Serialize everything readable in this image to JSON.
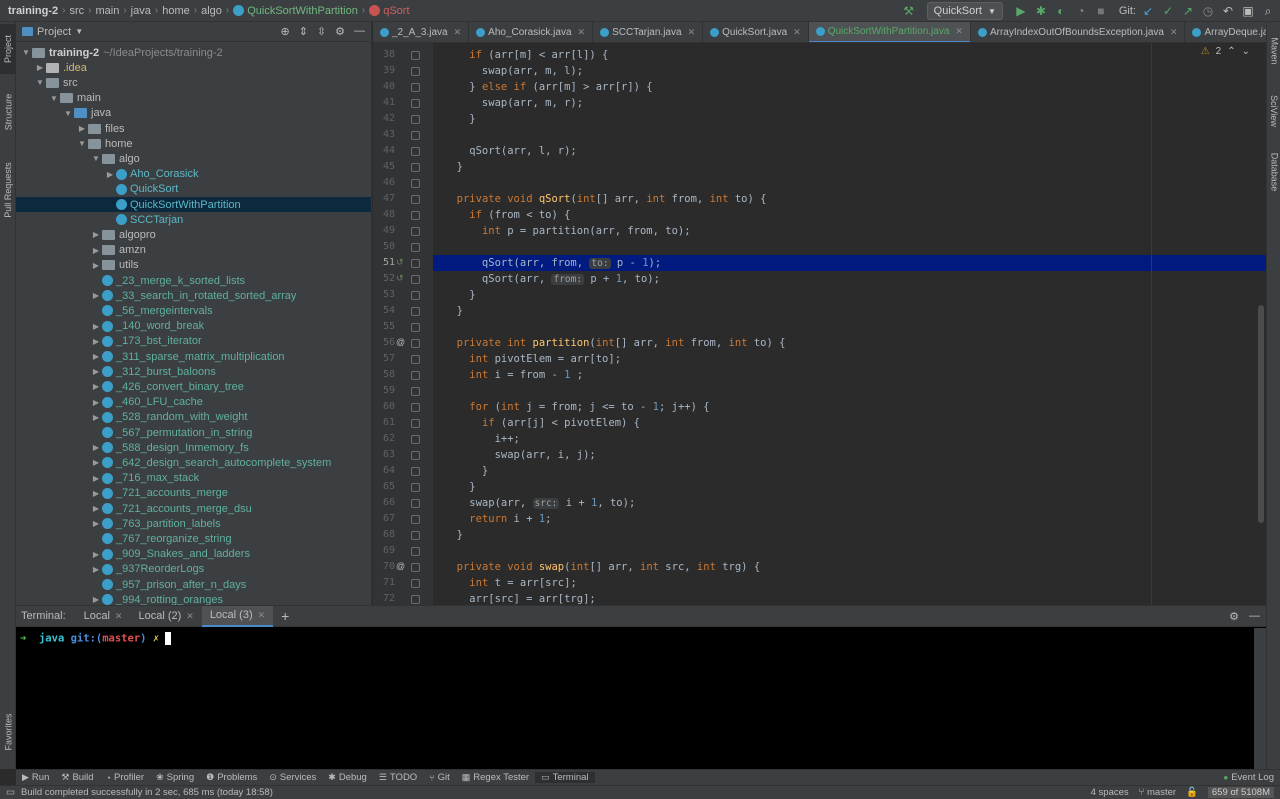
{
  "navbar": {
    "project": "training-2",
    "crumbs": [
      "src",
      "main",
      "java",
      "home",
      "algo"
    ],
    "class_crumb": "QuickSortWithPartition",
    "method_crumb": "qSort",
    "run_config": "QuickSort",
    "git_label": "Git:"
  },
  "project_panel": {
    "title": "Project",
    "tree": [
      {
        "label": "training-2",
        "extra": "~/IdeaProjects/training-2",
        "indent": 0,
        "type": "module",
        "arrow": "down"
      },
      {
        "label": ".idea",
        "indent": 1,
        "type": "folder-idea",
        "arrow": "right",
        "color": "yellow"
      },
      {
        "label": "src",
        "indent": 1,
        "type": "folder",
        "arrow": "down"
      },
      {
        "label": "main",
        "indent": 2,
        "type": "folder",
        "arrow": "down"
      },
      {
        "label": "java",
        "indent": 3,
        "type": "folder-blue",
        "arrow": "down"
      },
      {
        "label": "files",
        "indent": 4,
        "type": "folder",
        "arrow": "right"
      },
      {
        "label": "home",
        "indent": 4,
        "type": "folder",
        "arrow": "down"
      },
      {
        "label": "algo",
        "indent": 5,
        "type": "folder",
        "arrow": "down"
      },
      {
        "label": "Aho_Corasick",
        "indent": 6,
        "type": "class",
        "arrow": "right"
      },
      {
        "label": "QuickSort",
        "indent": 6,
        "type": "class",
        "arrow": ""
      },
      {
        "label": "QuickSortWithPartition",
        "indent": 6,
        "type": "class",
        "arrow": "",
        "selected": true
      },
      {
        "label": "SCCTarjan",
        "indent": 6,
        "type": "class",
        "arrow": ""
      },
      {
        "label": "algopro",
        "indent": 5,
        "type": "folder",
        "arrow": "right"
      },
      {
        "label": "amzn",
        "indent": 5,
        "type": "folder",
        "arrow": "right"
      },
      {
        "label": "utils",
        "indent": 5,
        "type": "folder",
        "arrow": "right"
      },
      {
        "label": "_23_merge_k_sorted_lists",
        "indent": 5,
        "type": "class2",
        "arrow": ""
      },
      {
        "label": "_33_search_in_rotated_sorted_array",
        "indent": 5,
        "type": "class2",
        "arrow": "right"
      },
      {
        "label": "_56_mergeintervals",
        "indent": 5,
        "type": "class2",
        "arrow": ""
      },
      {
        "label": "_140_word_break",
        "indent": 5,
        "type": "class2",
        "arrow": "right"
      },
      {
        "label": "_173_bst_iterator",
        "indent": 5,
        "type": "class2",
        "arrow": "right"
      },
      {
        "label": "_311_sparse_matrix_multiplication",
        "indent": 5,
        "type": "class2",
        "arrow": "right"
      },
      {
        "label": "_312_burst_baloons",
        "indent": 5,
        "type": "class2",
        "arrow": "right"
      },
      {
        "label": "_426_convert_binary_tree",
        "indent": 5,
        "type": "class2",
        "arrow": "right"
      },
      {
        "label": "_460_LFU_cache",
        "indent": 5,
        "type": "class2",
        "arrow": "right"
      },
      {
        "label": "_528_random_with_weight",
        "indent": 5,
        "type": "class2",
        "arrow": "right"
      },
      {
        "label": "_567_permutation_in_string",
        "indent": 5,
        "type": "class2",
        "arrow": ""
      },
      {
        "label": "_588_design_Inmemory_fs",
        "indent": 5,
        "type": "class2",
        "arrow": "right"
      },
      {
        "label": "_642_design_search_autocomplete_system",
        "indent": 5,
        "type": "class2",
        "arrow": "right"
      },
      {
        "label": "_716_max_stack",
        "indent": 5,
        "type": "class2",
        "arrow": "right"
      },
      {
        "label": "_721_accounts_merge",
        "indent": 5,
        "type": "class2",
        "arrow": "right"
      },
      {
        "label": "_721_accounts_merge_dsu",
        "indent": 5,
        "type": "class2",
        "arrow": "right"
      },
      {
        "label": "_763_partition_labels",
        "indent": 5,
        "type": "class2",
        "arrow": "right"
      },
      {
        "label": "_767_reorganize_string",
        "indent": 5,
        "type": "class2",
        "arrow": ""
      },
      {
        "label": "_909_Snakes_and_ladders",
        "indent": 5,
        "type": "class2",
        "arrow": "right"
      },
      {
        "label": "_937ReorderLogs",
        "indent": 5,
        "type": "class2",
        "arrow": "right"
      },
      {
        "label": "_957_prison_after_n_days",
        "indent": 5,
        "type": "class2",
        "arrow": ""
      },
      {
        "label": "_994_rotting_oranges",
        "indent": 5,
        "type": "class2",
        "arrow": "right"
      }
    ]
  },
  "editor_tabs": [
    {
      "label": "_2_A_3.java",
      "style": "normal"
    },
    {
      "label": "Aho_Corasick.java",
      "style": "normal"
    },
    {
      "label": "SCCTarjan.java",
      "style": "normal"
    },
    {
      "label": "QuickSort.java",
      "style": "normal"
    },
    {
      "label": "QuickSortWithPartition.java",
      "style": "active"
    },
    {
      "label": "ArrayIndexOutOfBoundsException.java",
      "style": "normal"
    },
    {
      "label": "ArrayDeque.java",
      "style": "normal"
    }
  ],
  "inspection": {
    "warnings": "2"
  },
  "code": [
    {
      "n": "38",
      "t": [
        [
          "    ",
          ""
        ],
        [
          "if",
          "kw"
        ],
        [
          " (arr[m] < arr[l]) {",
          ""
        ]
      ]
    },
    {
      "n": "39",
      "t": [
        [
          "      swap(arr, m, l);",
          ""
        ]
      ]
    },
    {
      "n": "40",
      "t": [
        [
          "    } ",
          ""
        ],
        [
          "else if",
          "kw"
        ],
        [
          " (arr[m] > arr[r]) {",
          ""
        ]
      ]
    },
    {
      "n": "41",
      "t": [
        [
          "      swap(arr, m, r);",
          ""
        ]
      ]
    },
    {
      "n": "42",
      "t": [
        [
          "    }",
          ""
        ]
      ]
    },
    {
      "n": "43",
      "t": []
    },
    {
      "n": "44",
      "t": [
        [
          "    qSort(arr, l, r);",
          ""
        ]
      ]
    },
    {
      "n": "45",
      "t": [
        [
          "  }",
          ""
        ]
      ]
    },
    {
      "n": "46",
      "t": []
    },
    {
      "n": "47",
      "t": [
        [
          "  ",
          ""
        ],
        [
          "private void ",
          "kw"
        ],
        [
          "qSort",
          "fn"
        ],
        [
          "(",
          ""
        ],
        [
          "int",
          "kw"
        ],
        [
          "[] arr, ",
          ""
        ],
        [
          "int",
          "kw"
        ],
        [
          " from, ",
          ""
        ],
        [
          "int",
          "kw"
        ],
        [
          " to) {",
          ""
        ]
      ]
    },
    {
      "n": "48",
      "t": [
        [
          "    ",
          ""
        ],
        [
          "if",
          "kw"
        ],
        [
          " (from < to) {",
          ""
        ]
      ]
    },
    {
      "n": "49",
      "t": [
        [
          "      ",
          ""
        ],
        [
          "int",
          "kw"
        ],
        [
          " p = partition(arr, from, to);",
          ""
        ]
      ]
    },
    {
      "n": "50",
      "t": []
    },
    {
      "n": "51",
      "t": [
        [
          "      qSort(arr, from, ",
          ""
        ],
        [
          "to:",
          "hint"
        ],
        [
          " p - ",
          ""
        ],
        [
          "1",
          "num"
        ],
        [
          ");",
          ""
        ]
      ],
      "current": true,
      "mark": "↺"
    },
    {
      "n": "52",
      "t": [
        [
          "      qSort(arr, ",
          ""
        ],
        [
          "from:",
          "hint"
        ],
        [
          " p + ",
          ""
        ],
        [
          "1",
          "num"
        ],
        [
          ", to);",
          ""
        ]
      ],
      "mark": "↺"
    },
    {
      "n": "53",
      "t": [
        [
          "    }",
          ""
        ]
      ]
    },
    {
      "n": "54",
      "t": [
        [
          "  }",
          ""
        ]
      ]
    },
    {
      "n": "55",
      "t": []
    },
    {
      "n": "56",
      "t": [
        [
          "  ",
          ""
        ],
        [
          "private int ",
          "kw"
        ],
        [
          "partition",
          "fn"
        ],
        [
          "(",
          ""
        ],
        [
          "int",
          "kw"
        ],
        [
          "[] arr, ",
          ""
        ],
        [
          "int",
          "kw"
        ],
        [
          " from, ",
          ""
        ],
        [
          "int",
          "kw"
        ],
        [
          " to) {",
          ""
        ]
      ],
      "mark": "@"
    },
    {
      "n": "57",
      "t": [
        [
          "    ",
          ""
        ],
        [
          "int",
          "kw"
        ],
        [
          " pivotElem = arr[to];",
          ""
        ]
      ]
    },
    {
      "n": "58",
      "t": [
        [
          "    ",
          ""
        ],
        [
          "int",
          "kw"
        ],
        [
          " i = from - ",
          ""
        ],
        [
          "1",
          "num"
        ],
        [
          " ;",
          ""
        ]
      ]
    },
    {
      "n": "59",
      "t": []
    },
    {
      "n": "60",
      "t": [
        [
          "    ",
          ""
        ],
        [
          "for",
          "kw"
        ],
        [
          " (",
          ""
        ],
        [
          "int",
          "kw"
        ],
        [
          " j = from; j <= to - ",
          ""
        ],
        [
          "1",
          "num"
        ],
        [
          "; j++) {",
          ""
        ]
      ]
    },
    {
      "n": "61",
      "t": [
        [
          "      ",
          ""
        ],
        [
          "if",
          "kw"
        ],
        [
          " (arr[j] < pivotElem) {",
          ""
        ]
      ]
    },
    {
      "n": "62",
      "t": [
        [
          "        i++;",
          ""
        ]
      ]
    },
    {
      "n": "63",
      "t": [
        [
          "        swap(arr, i, j);",
          ""
        ]
      ]
    },
    {
      "n": "64",
      "t": [
        [
          "      }",
          ""
        ]
      ]
    },
    {
      "n": "65",
      "t": [
        [
          "    }",
          ""
        ]
      ]
    },
    {
      "n": "66",
      "t": [
        [
          "    swap(arr, ",
          ""
        ],
        [
          "src:",
          "hint"
        ],
        [
          " i + ",
          ""
        ],
        [
          "1",
          "num"
        ],
        [
          ", to);",
          ""
        ]
      ]
    },
    {
      "n": "67",
      "t": [
        [
          "    ",
          ""
        ],
        [
          "return",
          "kw"
        ],
        [
          " i + ",
          ""
        ],
        [
          "1",
          "num"
        ],
        [
          ";",
          ""
        ]
      ]
    },
    {
      "n": "68",
      "t": [
        [
          "  }",
          ""
        ]
      ]
    },
    {
      "n": "69",
      "t": []
    },
    {
      "n": "70",
      "t": [
        [
          "  ",
          ""
        ],
        [
          "private void ",
          "kw"
        ],
        [
          "swap",
          "fn"
        ],
        [
          "(",
          ""
        ],
        [
          "int",
          "kw"
        ],
        [
          "[] arr, ",
          ""
        ],
        [
          "int",
          "kw"
        ],
        [
          " src, ",
          ""
        ],
        [
          "int",
          "kw"
        ],
        [
          " trg) {",
          ""
        ]
      ],
      "mark": "@"
    },
    {
      "n": "71",
      "t": [
        [
          "    ",
          ""
        ],
        [
          "int",
          "kw"
        ],
        [
          " t = arr[src];",
          ""
        ]
      ]
    },
    {
      "n": "72",
      "t": [
        [
          "    arr[src] = arr[trg];",
          ""
        ]
      ]
    }
  ],
  "terminal": {
    "title": "Terminal:",
    "tabs": [
      "Local",
      "Local (2)",
      "Local (3)"
    ],
    "active_tab": 2,
    "prompt_arrow": "➜",
    "prompt_dir": "java",
    "prompt_git": "git:(",
    "prompt_branch": "master",
    "prompt_git_end": ")",
    "prompt_x": "✗"
  },
  "left_stripe": {
    "project": "Project",
    "structure": "Structure",
    "pull": "Pull Requests",
    "favorites": "Favorites"
  },
  "right_stripe": {
    "maven": "Maven",
    "sciview": "SciView",
    "database": "Database"
  },
  "tool_windows": [
    "Run",
    "Build",
    "Profiler",
    "Spring",
    "Problems",
    "Services",
    "Debug",
    "TODO",
    "Git",
    "Regex Tester",
    "Terminal"
  ],
  "tool_active": "Terminal",
  "event_log": "Event Log",
  "status": {
    "message": "Build completed successfully in 2 sec, 685 ms (today 18:58)",
    "indent": "4 spaces",
    "branch": "master",
    "memory": "659 of 5108M"
  }
}
